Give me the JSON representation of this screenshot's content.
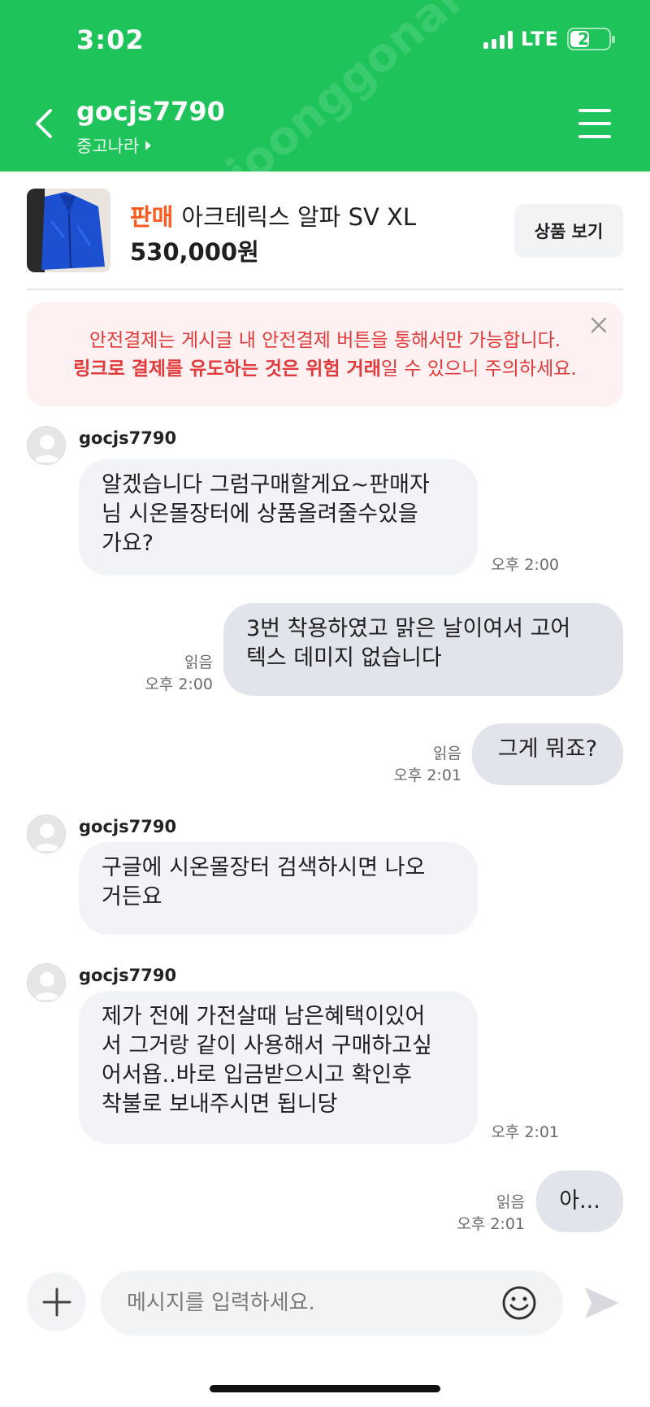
{
  "status_bar": {
    "time": "3:02",
    "network": "LTE",
    "battery": "26"
  },
  "header": {
    "title": "gocjs7790",
    "subtitle": "중고나라",
    "watermark": "joonggonara"
  },
  "product": {
    "tag": "판매",
    "name": "아크테릭스 알파 SV XL",
    "price": "530,000원",
    "view_button": "상품 보기"
  },
  "warning": {
    "line1": "안전결제는 게시글 내 안전결제 버튼을 통해서만 가능합니다.",
    "line2_bold": "링크로 결제를 유도하는 것은 위험 거래",
    "line2_rest": "일 수 있으니 주의하세요."
  },
  "messages": [
    {
      "side": "in",
      "sender": "gocjs7790",
      "text": "알겠습니다 그럼구매할게요~판매자\n님 시온몰장터에 상품올려줄수있을\n가요?",
      "time": "오후 2:00"
    },
    {
      "side": "out",
      "read": "읽음",
      "text": "3번 착용하였고 맑은 날이여서 고어\n텍스 데미지 없습니다",
      "time": "오후 2:00"
    },
    {
      "side": "out",
      "read": "읽음",
      "text": "그게 뭐죠?",
      "time": "오후 2:01"
    },
    {
      "side": "in",
      "sender": "gocjs7790",
      "text": "구글에 시온몰장터 검색하시면 나오\n거든요",
      "time": ""
    },
    {
      "side": "in",
      "sender": "gocjs7790",
      "text": "제가 전에 가전살때 남은혜택이있어\n서 그거랑 같이 사용해서 구매하고싶\n어서욥..바로 입금받으시고 확인후\n착불로 보내주시면 됩니당",
      "time": "오후 2:01"
    },
    {
      "side": "out",
      "read": "읽음",
      "text": "아...",
      "time": "오후 2:01"
    }
  ],
  "input": {
    "placeholder": "메시지를 입력하세요."
  },
  "colors": {
    "header": "#1ec45a",
    "sale_tag": "#ff5a1f",
    "warning_text": "#e23a3a",
    "warning_bg": "#fff1f1"
  }
}
